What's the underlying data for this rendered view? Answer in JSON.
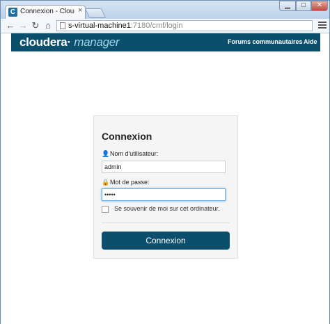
{
  "browser": {
    "tab_title": "Connexion - Cloudera Ma",
    "url_host": "s-virtual-machine1",
    "url_path": ":7180/cmf/login",
    "tab_favicon": "C"
  },
  "header": {
    "logo_part1": "cloudera",
    "logo_part2": "manager",
    "links": [
      "Forums communautaires",
      "Aide"
    ],
    "color": "#0b4f6c"
  },
  "login": {
    "title": "Connexion",
    "username_label": "Nom d'utilisateur:",
    "username_value": "admin",
    "password_label": "Mot de passe:",
    "password_value": "•••••",
    "remember_label": "Se souvenir de moi sur cet ordinateur.",
    "submit_label": "Connexion"
  },
  "icons": [
    "user-icon",
    "lock-icon",
    "back-icon",
    "forward-icon",
    "reload-icon",
    "home-icon",
    "menu-icon"
  ]
}
